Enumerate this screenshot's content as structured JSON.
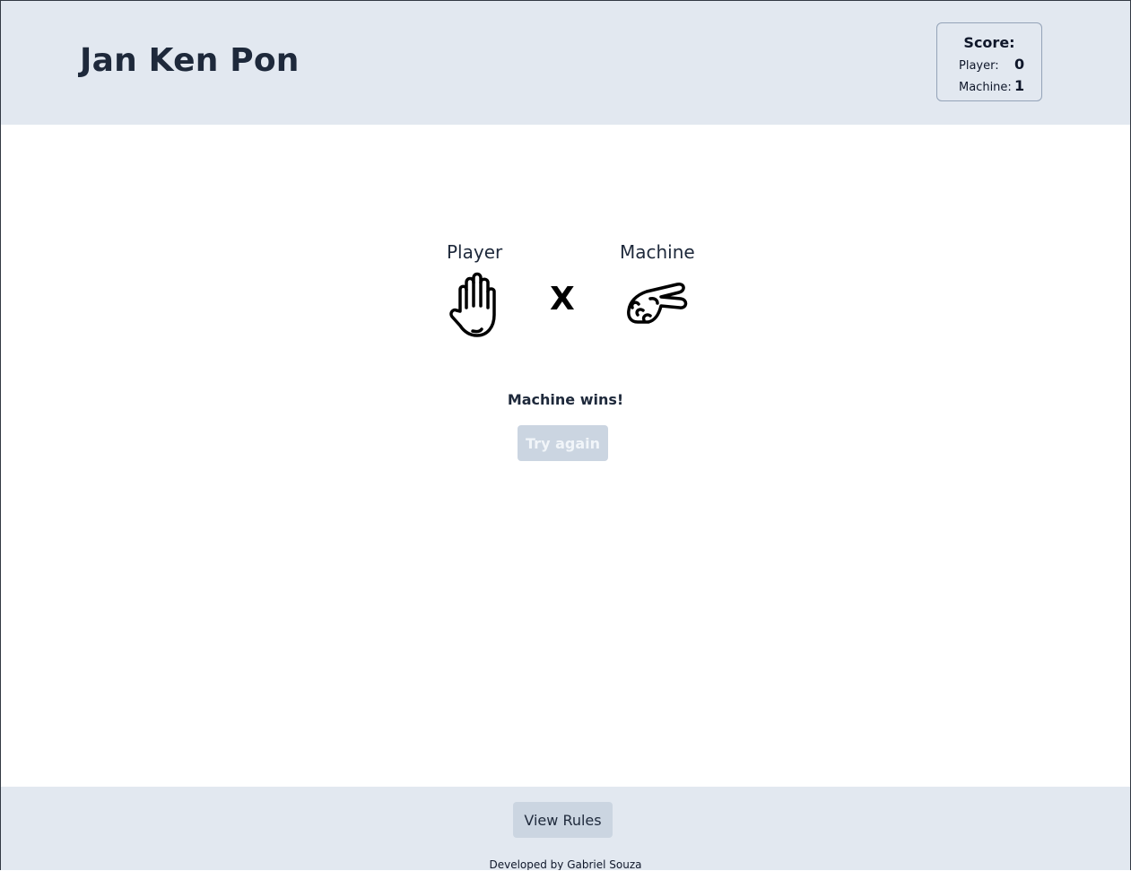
{
  "header": {
    "title": "Jan Ken Pon"
  },
  "score": {
    "title": "Score:",
    "player_label": "Player:",
    "player_value": "0",
    "machine_label": "Machine:",
    "machine_value": "1"
  },
  "match": {
    "player_label": "Player",
    "machine_label": "Machine",
    "versus": "X",
    "player_choice_icon": "paper-hand-icon",
    "machine_choice_icon": "scissors-hand-icon"
  },
  "result": {
    "message": "Machine wins!",
    "try_again_label": "Try again"
  },
  "footer": {
    "rules_label": "View Rules",
    "credits": "Developed by Gabriel Souza"
  },
  "colors": {
    "header_bg": "#e2e8f0",
    "button_bg": "#cbd5e1",
    "text": "#1e293b"
  }
}
